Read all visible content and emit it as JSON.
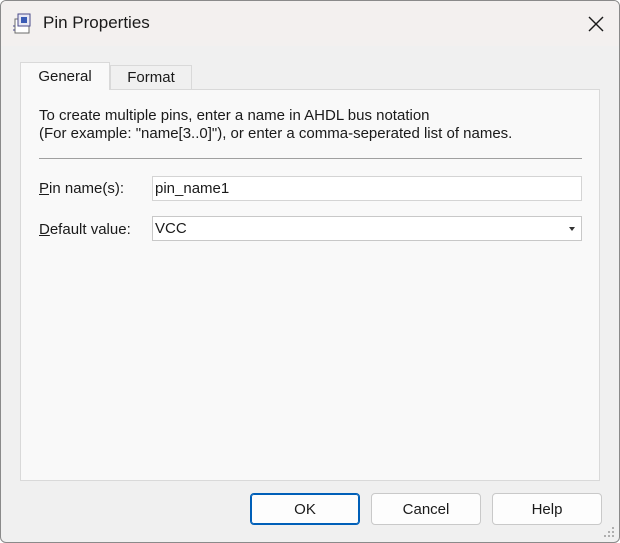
{
  "window": {
    "title": "Pin Properties",
    "app_icon": "pin-properties-icon",
    "close_icon": "close-icon"
  },
  "tabs": [
    {
      "label": "General",
      "selected": true
    },
    {
      "label": "Format",
      "selected": false
    }
  ],
  "general": {
    "help_line1": "To create multiple pins, enter a name in AHDL bus notation",
    "help_line2": "(For example: \"name[3..0]\"), or enter a comma-seperated list of names.",
    "pin_name_label_mnemonic": "P",
    "pin_name_label_rest": "in name(s):",
    "pin_name_value": "pin_name1",
    "default_label_mnemonic": "D",
    "default_label_rest": "efault value:",
    "default_value": "VCC"
  },
  "buttons": {
    "ok": "OK",
    "cancel": "Cancel",
    "help": "Help"
  },
  "colors": {
    "accent": "#005fb8",
    "titlebar": "#f3f0ef",
    "dialog_bg": "#f0f0f0",
    "panel_bg": "#f9f9f9"
  }
}
